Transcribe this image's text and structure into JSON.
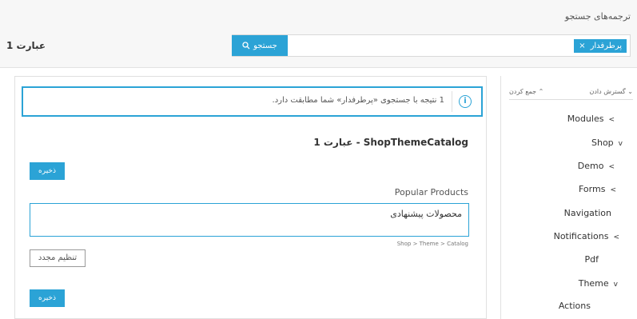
{
  "search": {
    "title": "ترجمه‌های جستجو",
    "tag_label": "پرطرفدار",
    "tag_remove": "×",
    "button_label": "جستجو",
    "button_icon": "search-icon"
  },
  "header": {
    "page_label": "عبارت 1"
  },
  "sidebar": {
    "expand_label": "گسترش دادن",
    "collapse_label": "جمع کردن",
    "items": [
      {
        "label": "Modules",
        "arrow": "<"
      },
      {
        "label": "Shop",
        "arrow": "v"
      },
      {
        "label": "Demo",
        "arrow": "<"
      },
      {
        "label": "Forms",
        "arrow": "<"
      },
      {
        "label": "Navigation",
        "arrow": ""
      },
      {
        "label": "Notifications",
        "arrow": "<"
      },
      {
        "label": "Pdf",
        "arrow": ""
      },
      {
        "label": "Theme",
        "arrow": "v"
      },
      {
        "label": "Actions",
        "arrow": ""
      }
    ]
  },
  "main": {
    "info_text": "1 نتیجه با جستجوی «پرطرفدار» شما مطابقت دارد.",
    "info_icon": "i",
    "section_title": "ShopThemeCatalog - عبارت 1",
    "save_label": "ذخیره",
    "field_label": "Popular Products",
    "field_value": "محصولات پیشنهادی",
    "breadcrumb": "Shop > Theme > Catalog",
    "reset_label": "تنظیم مجدد",
    "save_label_2": "ذخیره"
  },
  "colors": {
    "accent": "#2ba3d6"
  }
}
